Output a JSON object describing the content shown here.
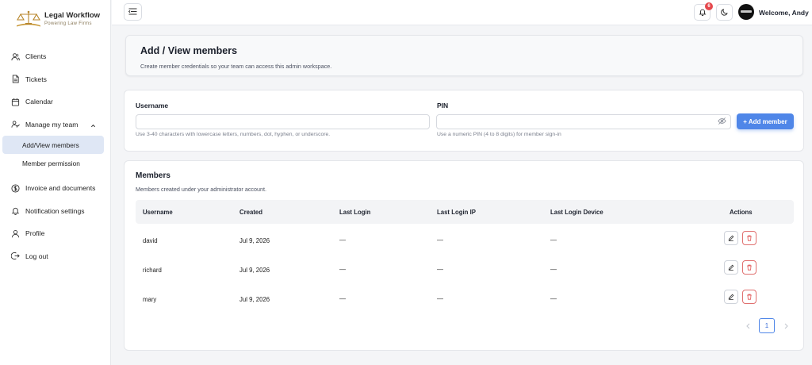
{
  "brand": {
    "title": "Legal Workflow",
    "tagline": "Powering Law Firms",
    "accent": "#b8862b"
  },
  "sidebar": {
    "items": [
      {
        "label": "Clients",
        "icon": "users-icon"
      },
      {
        "label": "Tickets",
        "icon": "file-icon"
      },
      {
        "label": "Calendar",
        "icon": "calendar-icon"
      },
      {
        "label": "Manage my team",
        "icon": "team-icon"
      },
      {
        "label": "Invoice and documents",
        "icon": "dollar-icon"
      },
      {
        "label": "Notification settings",
        "icon": "bell-icon"
      },
      {
        "label": "Profile",
        "icon": "user-icon"
      },
      {
        "label": "Log out",
        "icon": "logout-icon"
      }
    ],
    "sub_items": [
      {
        "label": "Add/View members",
        "active": true
      },
      {
        "label": "Member permission",
        "active": false
      }
    ]
  },
  "topbar": {
    "notification_count": "6",
    "welcome": "Welcome, Andy"
  },
  "page": {
    "title": "Add / View members",
    "subtitle": "Create member credentials so your team can access this admin workspace."
  },
  "form": {
    "username_label": "Username",
    "username_value": "",
    "username_hint": "Use 3-40 characters with lowercase letters, numbers, dot, hyphen, or underscore.",
    "pin_label": "PIN",
    "pin_value": "",
    "pin_hint": "Use a numeric PIN (4 to 8 digits) for member sign-in",
    "add_button": "+ Add member",
    "accent": "#4f86e8"
  },
  "members": {
    "title": "Members",
    "subtitle": "Members created under your administrator account.",
    "columns": [
      "Username",
      "Created",
      "Last Login",
      "Last Login IP",
      "Last Login Device",
      "Actions"
    ],
    "rows": [
      {
        "username": "david",
        "created": "Jul 9, 2026",
        "last_login": "—",
        "last_login_ip": "—",
        "last_login_device": "—"
      },
      {
        "username": "richard",
        "created": "Jul 9, 2026",
        "last_login": "—",
        "last_login_ip": "—",
        "last_login_device": "—"
      },
      {
        "username": "mary",
        "created": "Jul 9, 2026",
        "last_login": "—",
        "last_login_ip": "—",
        "last_login_device": "—"
      }
    ],
    "current_page": "1"
  }
}
